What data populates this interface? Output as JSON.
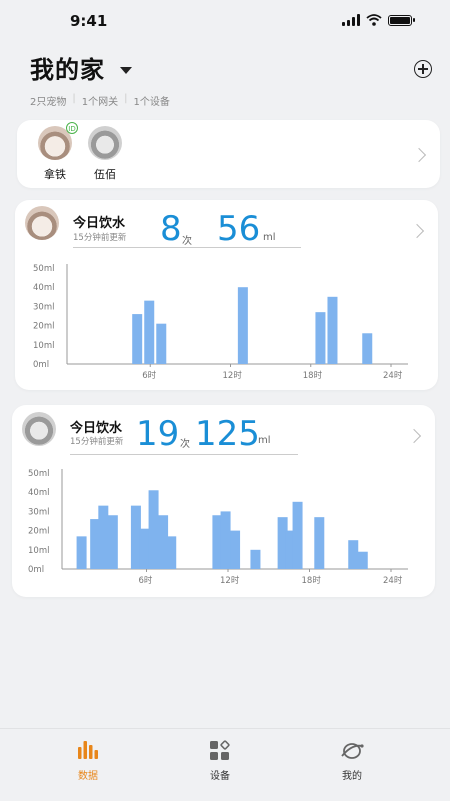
{
  "status": {
    "time": "9:41"
  },
  "header": {
    "title": "我的家",
    "summary": [
      "2只宠物",
      "1个网关",
      "1个设备"
    ]
  },
  "pets": [
    {
      "name": "拿铁",
      "badge": "ID"
    },
    {
      "name": "伍佰"
    }
  ],
  "cards": [
    {
      "title": "今日饮水",
      "subtitle": "15分钟前更新",
      "count": "8",
      "count_unit": "次",
      "volume": "56",
      "volume_unit": "ml"
    },
    {
      "title": "今日饮水",
      "subtitle": "15分钟前更新",
      "count": "19",
      "count_unit": "次",
      "volume": "125",
      "volume_unit": "ml"
    }
  ],
  "chart_data": [
    {
      "type": "bar",
      "bar_color": "#7fb3ee",
      "y_ticks": [
        "0ml",
        "10ml",
        "20ml",
        "30ml",
        "40ml",
        "50ml"
      ],
      "x_ticks": [
        "6时",
        "12时",
        "18时",
        "24时"
      ],
      "ylim": [
        0,
        50
      ],
      "xlim": [
        0,
        24
      ],
      "x": [
        4.8,
        5.7,
        6.6,
        12.7,
        18.5,
        19.4,
        22.0
      ],
      "values": [
        26,
        33,
        21,
        40,
        27,
        35,
        16
      ]
    },
    {
      "type": "bar",
      "bar_color": "#7fb3ee",
      "y_ticks": [
        "0ml",
        "10ml",
        "20ml",
        "30ml",
        "40ml",
        "50ml"
      ],
      "x_ticks": [
        "6时",
        "12时",
        "18时",
        "24时"
      ],
      "ylim": [
        0,
        50
      ],
      "xlim": [
        0,
        24
      ],
      "x": [
        1.0,
        2.0,
        2.6,
        3.3,
        5.0,
        5.6,
        6.3,
        7.0,
        7.6,
        11.0,
        11.6,
        12.3,
        13.8,
        15.8,
        16.4,
        16.9,
        18.5,
        21.0,
        21.7
      ],
      "values": [
        17,
        26,
        33,
        28,
        33,
        21,
        41,
        28,
        17,
        28,
        30,
        20,
        10,
        27,
        20,
        35,
        27,
        15,
        9
      ]
    }
  ],
  "tabs": [
    {
      "label": "数据",
      "icon": "bar-chart-icon",
      "active": true
    },
    {
      "label": "设备",
      "icon": "grid-icon",
      "active": false
    },
    {
      "label": "我的",
      "icon": "profile-icon",
      "active": false
    }
  ],
  "colors": {
    "accent": "#1a8ed6",
    "active_tab": "#e8861a",
    "bar": "#7fb3ee"
  }
}
